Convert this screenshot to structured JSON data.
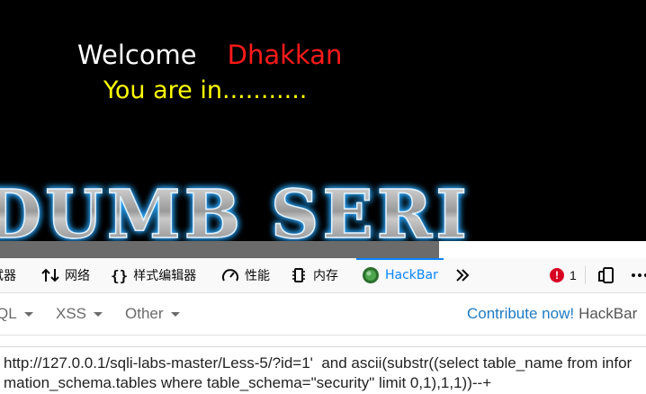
{
  "page": {
    "welcome_label": "Welcome",
    "username": "Dhakkan",
    "status": "You are in...........",
    "banner_text": "DUMB SERI",
    "colors": {
      "welcome": "#ffffff",
      "username": "#ff1a1a",
      "status": "#ffff00",
      "background": "#000000"
    }
  },
  "devtools": {
    "tabs": [
      {
        "label": "试器",
        "icon": "debugger-icon"
      },
      {
        "label": "网络",
        "icon": "network-icon"
      },
      {
        "label": "样式编辑器",
        "icon": "style-editor-icon"
      },
      {
        "label": "性能",
        "icon": "performance-icon"
      },
      {
        "label": "内存",
        "icon": "memory-icon"
      },
      {
        "label": "HackBar",
        "icon": "hackbar-icon",
        "active": true
      }
    ],
    "error_count": "1",
    "accent": "#0a84ff"
  },
  "hackbar": {
    "menu": [
      {
        "label": "QL"
      },
      {
        "label": "XSS"
      },
      {
        "label": "Other"
      }
    ],
    "contribute_label": "Contribute now!",
    "brand": "HackBar",
    "url_value": "http://127.0.0.1/sqli-labs-master/Less-5/?id=1'  and ascii(substr((select table_name from information_schema.tables where table_schema=\"security\" limit 0,1),1,1))--+"
  }
}
